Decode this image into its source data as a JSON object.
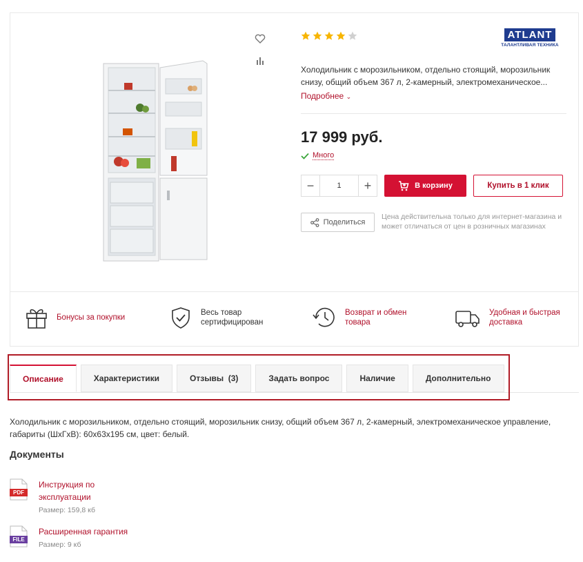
{
  "product": {
    "rating": 4,
    "rating_max": 5,
    "brand_name": "ATLANT",
    "brand_tagline": "ТАЛАНТЛИВАЯ ТЕХНИКА",
    "short_description": "Холодильник с морозильником, отдельно стоящий, морозильник снизу, общий объем 367 л, 2-камерный, электромеханическое...",
    "more_label": "Подробнее",
    "price": "17 999 руб.",
    "stock_label": "Много",
    "quantity": "1",
    "cart_label": "В корзину",
    "one_click_label": "Купить в 1 клик",
    "share_label": "Поделиться",
    "price_note": "Цена действительна только для интернет-магазина и может отличаться от цен в розничных магазинах"
  },
  "benefits": [
    {
      "label": "Бонусы за покупки",
      "icon": "gift-icon"
    },
    {
      "label": "Весь товар сертифицирован",
      "icon": "shield-check-icon"
    },
    {
      "label": "Возврат и обмен товара",
      "icon": "clock-return-icon"
    },
    {
      "label": "Удобная и быстрая доставка",
      "icon": "truck-icon"
    }
  ],
  "tabs": [
    {
      "label": "Описание",
      "active": true
    },
    {
      "label": "Характеристики",
      "active": false
    },
    {
      "label": "Отзывы  (3)",
      "active": false
    },
    {
      "label": "Задать вопрос",
      "active": false
    },
    {
      "label": "Наличие",
      "active": false
    },
    {
      "label": "Дополнительно",
      "active": false
    }
  ],
  "description": "Холодильник с морозильником, отдельно стоящий, морозильник снизу, общий объем 367 л, 2-камерный, электромеханическое управление, габариты (ШхГхВ): 60x63x195 см, цвет: белый.",
  "documents": {
    "title": "Документы",
    "items": [
      {
        "type_label": "PDF",
        "name": "Инструкция по эксплуатации",
        "size": "Размер: 159,8 кб",
        "color": "#d42a2a"
      },
      {
        "type_label": "FILE",
        "name": "Расширенная гарантия",
        "size": "Размер: 9 кб",
        "color": "#6a3fa0"
      }
    ]
  },
  "colors": {
    "accent": "#d41133",
    "star": "#f7b500",
    "star_empty": "#d0d0d0"
  }
}
